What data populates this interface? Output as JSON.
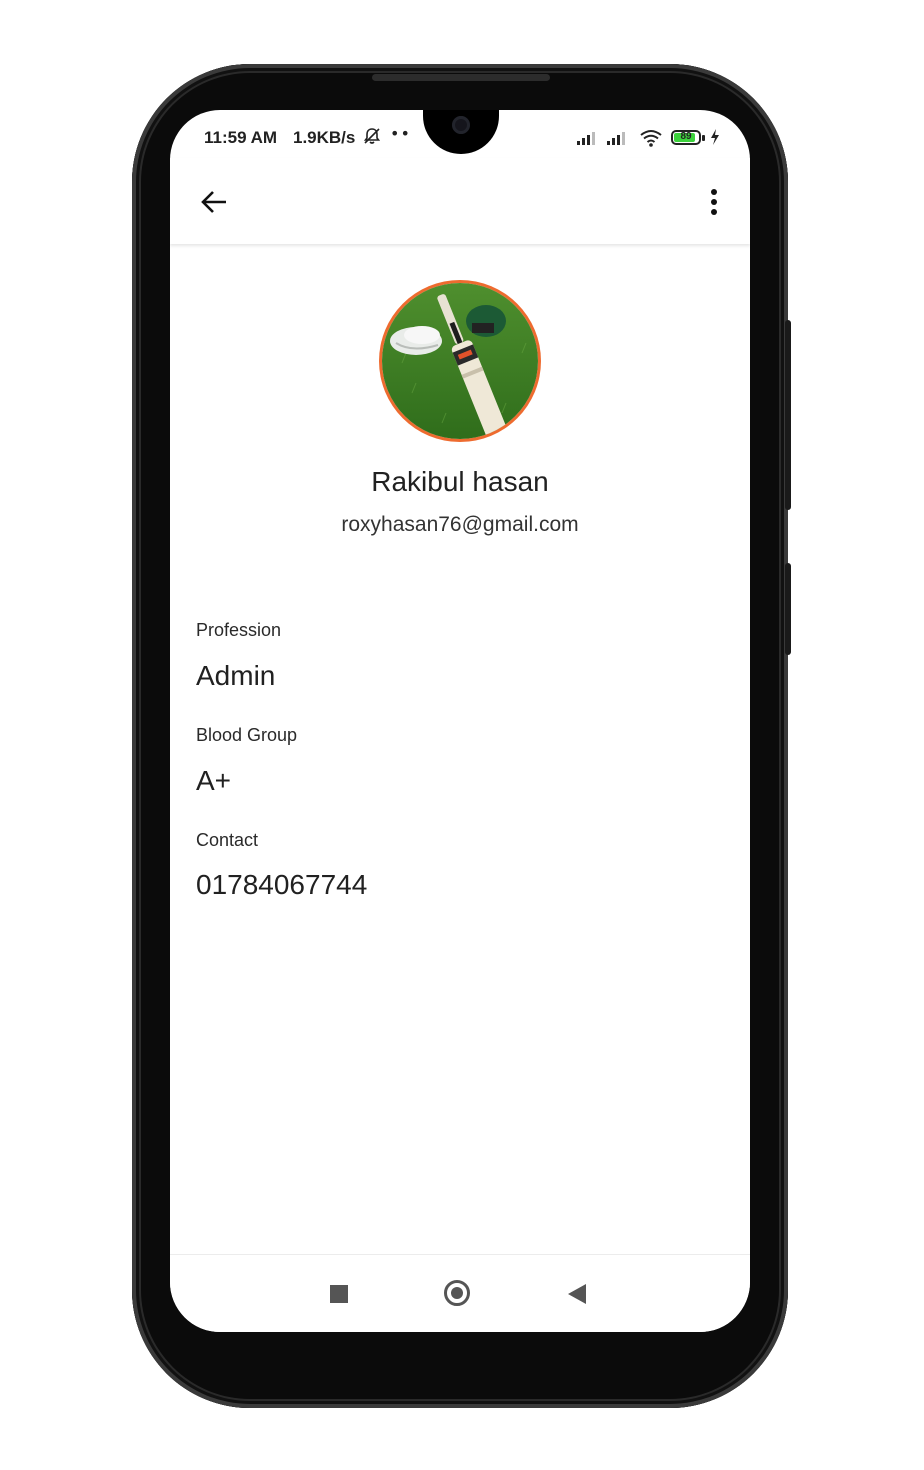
{
  "status_bar": {
    "time": "11:59 AM",
    "net_speed": "1.9KB/s",
    "battery_level": "89",
    "battery_fraction": 0.89,
    "icons": [
      "bell-off-icon",
      "more-dots-icon",
      "signal-icon",
      "signal-icon",
      "wifi-icon",
      "battery-icon",
      "charging-icon"
    ]
  },
  "app_bar": {
    "back_icon": "arrow-left-icon",
    "menu_icon": "more-vert-icon"
  },
  "profile": {
    "name": "Rakibul hasan",
    "email": "roxyhasan76@gmail.com",
    "avatar_ring_color": "#ee6b2f"
  },
  "fields": [
    {
      "label": "Profession",
      "value": "Admin"
    },
    {
      "label": "Blood Group",
      "value": "A+"
    },
    {
      "label": "Contact",
      "value": "01784067744"
    }
  ],
  "nav_bar": {
    "icons": [
      "square-recent-icon",
      "circle-home-icon",
      "triangle-back-icon"
    ]
  }
}
